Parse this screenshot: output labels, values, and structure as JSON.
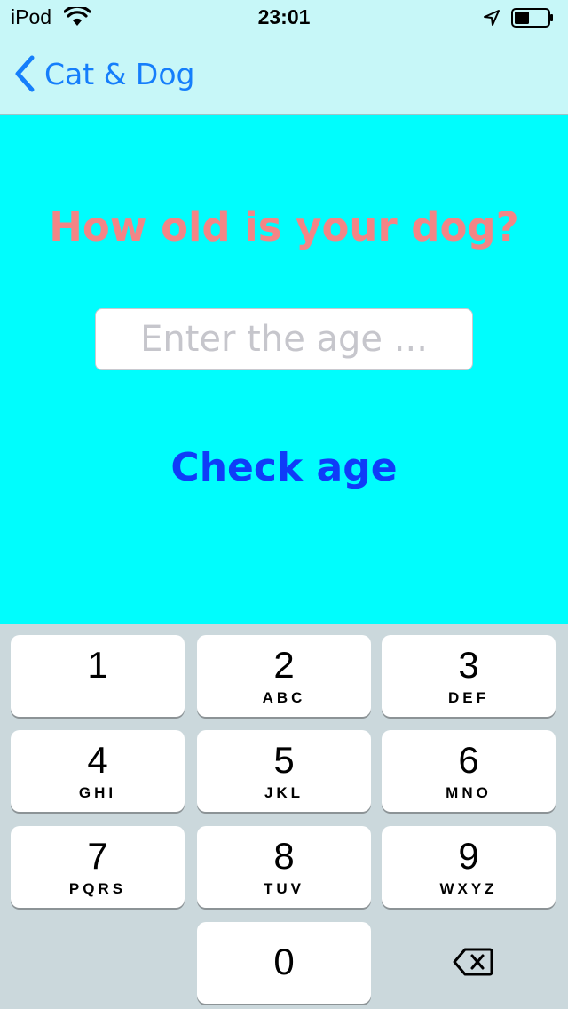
{
  "status_bar": {
    "carrier": "iPod",
    "time": "23:01"
  },
  "nav": {
    "back_label": "Cat & Dog"
  },
  "main": {
    "question": "How old is your dog?",
    "age_placeholder": "Enter the age ...",
    "age_value": "",
    "check_button": "Check age"
  },
  "keypad": {
    "keys": [
      {
        "digit": "1",
        "letters": ""
      },
      {
        "digit": "2",
        "letters": "ABC"
      },
      {
        "digit": "3",
        "letters": "DEF"
      },
      {
        "digit": "4",
        "letters": "GHI"
      },
      {
        "digit": "5",
        "letters": "JKL"
      },
      {
        "digit": "6",
        "letters": "MNO"
      },
      {
        "digit": "7",
        "letters": "PQRS"
      },
      {
        "digit": "8",
        "letters": "TUV"
      },
      {
        "digit": "9",
        "letters": "WXYZ"
      },
      {
        "digit": "0",
        "letters": ""
      }
    ],
    "delete_icon": "backspace-icon"
  },
  "colors": {
    "background": "#00fdfd",
    "bar_background": "#c7f7f8",
    "question_color": "#f38586",
    "check_button_color": "#0f3cf8",
    "back_color": "#157efb",
    "keypad_background": "#cbd8dc"
  }
}
